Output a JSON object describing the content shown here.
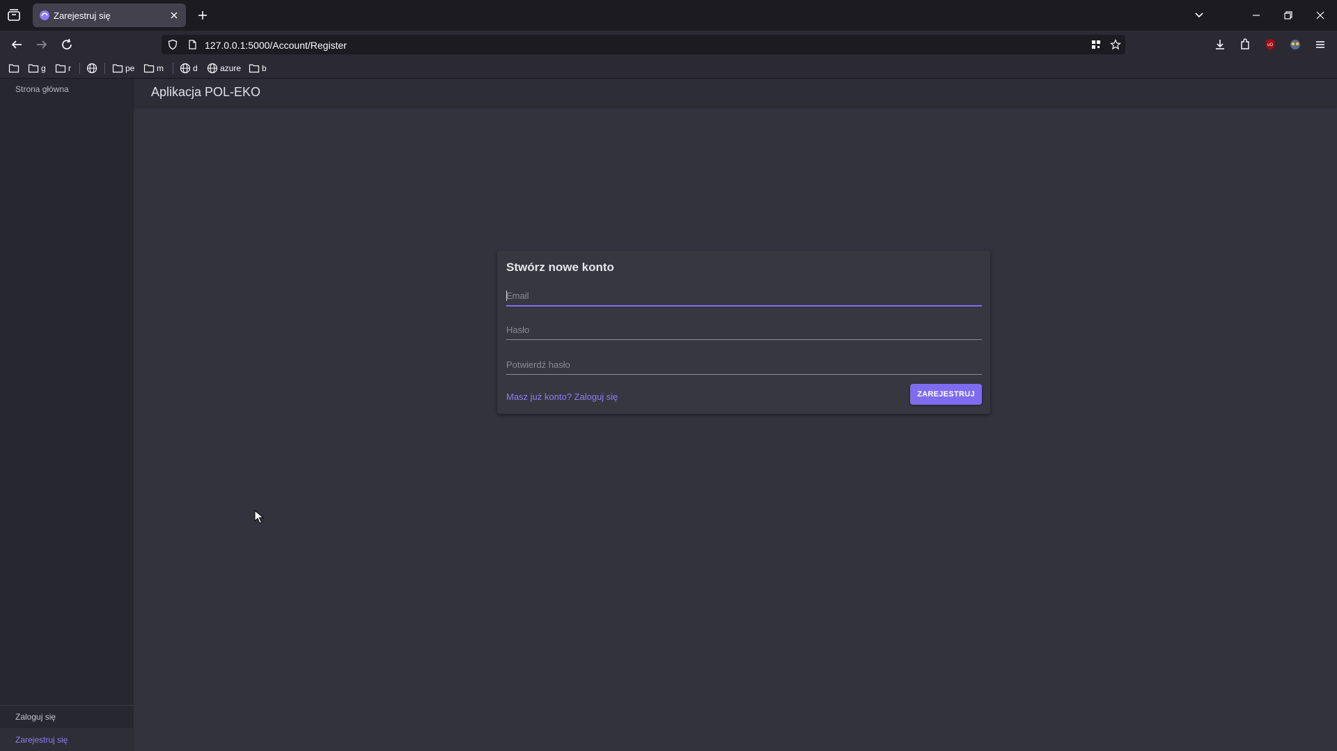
{
  "browser": {
    "tab": {
      "title": "Zarejestruj się"
    },
    "url": "127.0.0.1:5000/Account/Register",
    "bookmarks": [
      "g",
      "r",
      "pe",
      "m",
      "d",
      "azure",
      "b"
    ]
  },
  "app": {
    "title": "Aplikacja POL-EKO",
    "accent_color": "#7e6cf0",
    "background_color": "#32333d"
  },
  "sidebar": {
    "home": "Strona główna",
    "login": "Zaloguj się",
    "register": "Zarejestruj się",
    "active_item": "register"
  },
  "form": {
    "title": "Stwórz nowe konto",
    "email_placeholder": "Email",
    "password_placeholder": "Hasło",
    "confirm_placeholder": "Potwierdź hasło",
    "login_link": "Masz już konto? Zaloguj się",
    "submit_label": "ZAREJESTRUJ",
    "focused_field": "email"
  }
}
